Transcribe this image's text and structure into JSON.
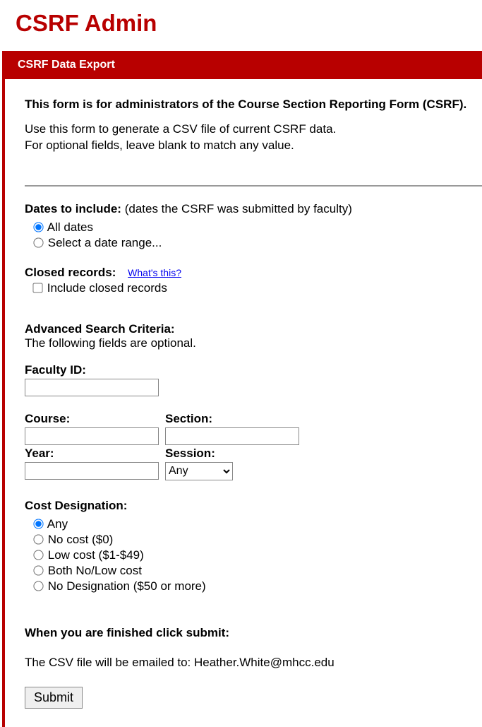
{
  "title": "CSRF Admin",
  "panel": {
    "header": "CSRF Data Export"
  },
  "intro": {
    "bold": "This form is for administrators of the Course Section Reporting Form (CSRF).",
    "line1": "Use this form to generate a CSV file of current CSRF data.",
    "line2": "For optional fields, leave blank to match any value."
  },
  "dates": {
    "label": "Dates to include:",
    "hint": "(dates the CSRF was submitted by faculty)",
    "options": {
      "all": "All dates",
      "range": "Select a date range..."
    }
  },
  "closed": {
    "label": "Closed records:",
    "help_link": "What's this?",
    "include_label": "Include closed records"
  },
  "advanced": {
    "title": "Advanced Search Criteria:",
    "subtitle": "The following fields are optional."
  },
  "fields": {
    "faculty_id": "Faculty ID:",
    "course": "Course:",
    "section": "Section:",
    "year": "Year:",
    "session": "Session:",
    "session_value": "Any"
  },
  "cost": {
    "label": "Cost Designation:",
    "options": {
      "any": "Any",
      "no": "No cost ($0)",
      "low": "Low cost ($1-$49)",
      "both": "Both No/Low cost",
      "none": "No Designation ($50 or more)"
    }
  },
  "finish": {
    "title": "When you are finished click submit:",
    "email_prefix": "The CSV file will be emailed to: ",
    "email": "Heather.White@mhcc.edu",
    "submit": "Submit"
  }
}
